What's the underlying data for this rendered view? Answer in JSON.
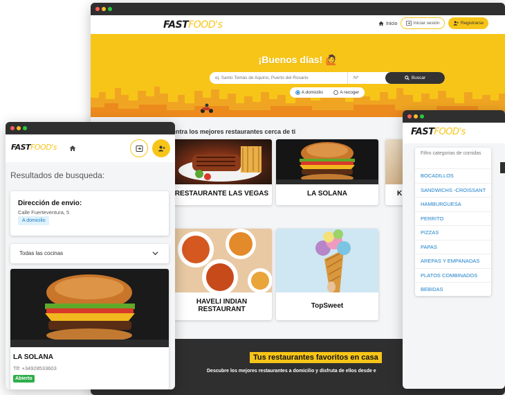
{
  "main_window": {
    "logo_bold": "FAST",
    "logo_light": "FOOD's",
    "nav_home": "Inicio",
    "nav_login": "Iniciar sesión",
    "nav_register": "Registrarse",
    "greeting": "¡Buenos días!",
    "greeting_emoji": "🙋",
    "address_placeholder": "ej. Santo Tomás de Aquino, Puerto del Rosario",
    "number_placeholder": "Nº",
    "search_button": "Buscar",
    "option_delivery": "A domicilio",
    "option_pickup": "A recoger",
    "section_title": "Encuentra los mejores restaurantes cerca de ti",
    "restaurants": [
      {
        "name": "RESTAURANTE LAS VEGAS"
      },
      {
        "name": "LA SOLANA"
      },
      {
        "name": "K"
      },
      {
        "name": "HAVELI INDIAN RESTAURANT"
      },
      {
        "name": "TopSweet"
      }
    ],
    "favorites_title": "Tus restaurantes favoritos en casa",
    "favorites_subtitle": "Descubre los mejores restaurantes a domicilio y disfruta de ellos desde e"
  },
  "left_window": {
    "logo_bold": "FAST",
    "logo_light": "FOOD's",
    "results_title": "Resultados de busqueda:",
    "address_label": "Dirección de envio:",
    "address_value": "Calle Fuerteventura, 5",
    "delivery_badge": "A domicilio",
    "cuisine_select": "Todas las cocinas",
    "restaurant_name": "LA SOLANA",
    "restaurant_phone": "Tlf: +34928533603",
    "status_badge": "Abierto"
  },
  "right_window": {
    "logo_bold": "FAST",
    "logo_light": "FOOD's",
    "filter_title": "Filtro categorias de comidas",
    "categories": [
      "BOCADILLOS",
      "SANDWICHS -CROISSANT",
      "HAMBURGUESA",
      "PERRITO",
      "PIZZAS",
      "PAPAS",
      "AREPAS Y EMPANADAS",
      "PLATOS COMBINADOS",
      "BEBIDAS"
    ]
  },
  "colors": {
    "brand_yellow": "#f7c518",
    "dark": "#2f2f2f",
    "link_blue": "#1a7fc9",
    "open_green": "#2fae4a"
  }
}
